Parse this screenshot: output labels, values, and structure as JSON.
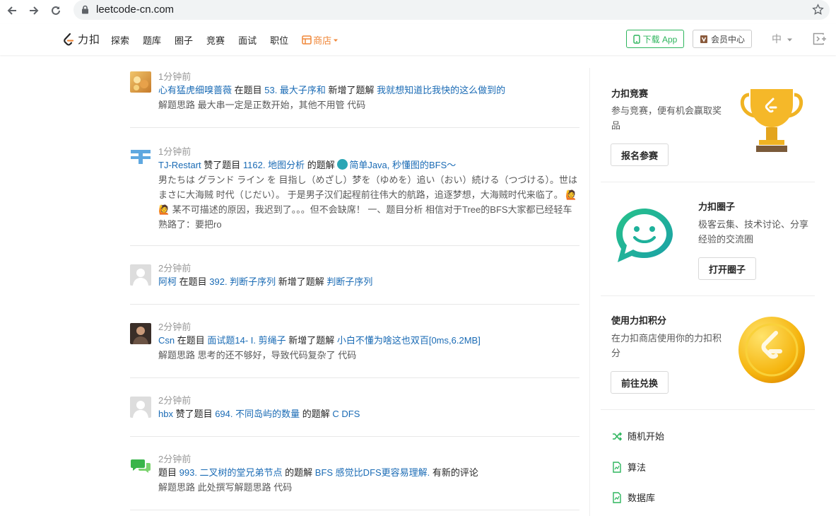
{
  "browser": {
    "url": "leetcode-cn.com"
  },
  "header": {
    "logo_text": "力扣",
    "nav": [
      "探索",
      "题库",
      "圈子",
      "竞赛",
      "面试",
      "职位"
    ],
    "store_label": "商店",
    "download_label": "下载 App",
    "vip_label": "会员中心",
    "lang_label": "中"
  },
  "feed": [
    {
      "time": "1分钟前",
      "user": "心有猛虎细嗅蔷薇",
      "t1": " 在题目 ",
      "problem": "53. 最大子序和",
      "t2": " 新增了题解 ",
      "solution": "我就想知道比我快的这么做到的",
      "desc": "解题思路 最大串一定是正数开始，其他不用管 代码"
    },
    {
      "time": "1分钟前",
      "user": "TJ-Restart",
      "t1": " 赞了题目 ",
      "problem": "1162. 地图分析",
      "t2": " 的题解 ",
      "solution": "简单Java, 秒懂图的BFS～",
      "desc": "男たちは グランド ライン を 目指し（めざし）梦を（ゆめを）追い（おい）続ける（つづける）。世はまさに大海贼 时代（じだい）。 于是男子汉们起程前往伟大的航路，追逐梦想，大海贼时代来临了。 🙋🙋 某不可描述的原因，我迟到了。。。但不会缺席！ 一、题目分析 相信对于Tree的BFS大家都已经轻车熟路了：要把ro"
    },
    {
      "time": "2分钟前",
      "user": "阿柯",
      "t1": " 在题目 ",
      "problem": "392. 判断子序列",
      "t2": " 新增了题解 ",
      "solution": "判断子序列",
      "desc": ""
    },
    {
      "time": "2分钟前",
      "user": "Csn",
      "t1": " 在题目 ",
      "problem": "面试题14- I. 剪绳子",
      "t2": " 新增了题解 ",
      "solution": "小白不懂为啥这也双百[0ms,6.2MB]",
      "desc": "解题思路 思考的还不够好，导致代码复杂了 代码"
    },
    {
      "time": "2分钟前",
      "user": "hbx",
      "t1": " 赞了题目 ",
      "problem": "694. 不同岛屿的数量",
      "t2": " 的题解 ",
      "solution": "C DFS",
      "desc": ""
    },
    {
      "time": "2分钟前",
      "user": "",
      "t1": "题目 ",
      "problem": "993. 二叉树的堂兄弟节点",
      "t2": " 的题解 ",
      "solution": "BFS 感觉比DFS更容易理解.",
      "t3": " 有新的评论",
      "desc": "解题思路 此处撰写解题思路 代码"
    }
  ],
  "sidebar": {
    "contest": {
      "title": "力扣竞赛",
      "text": "参与竞赛，便有机会赢取奖品",
      "button": "报名参赛"
    },
    "circle": {
      "title": "力扣圈子",
      "text": "极客云集、技术讨论、分享经验的交流圈",
      "button": "打开圈子"
    },
    "points": {
      "title": "使用力扣积分",
      "text": "在力扣商店使用你的力扣积分",
      "button": "前往兑换"
    },
    "links": [
      "随机开始",
      "算法",
      "数据库"
    ]
  },
  "colors": {
    "link_blue": "#1a6bb5",
    "brand_green": "#2db55d",
    "store_orange": "#f0883a",
    "trophy_gold": "#f0b323"
  }
}
